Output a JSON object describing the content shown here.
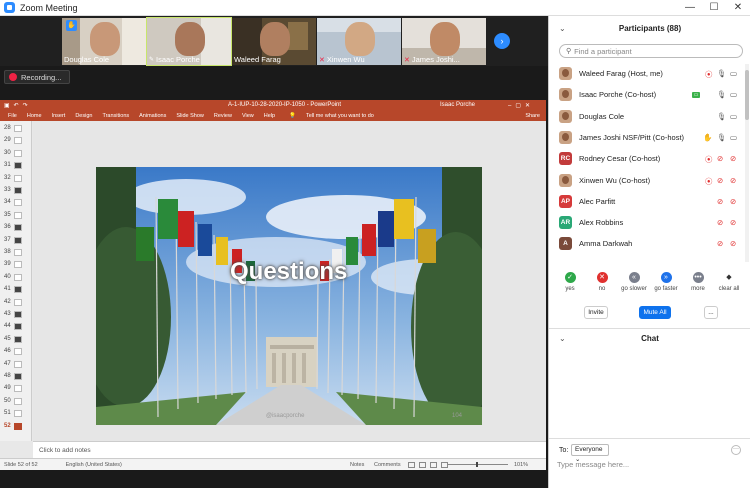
{
  "window": {
    "title": "Zoom Meeting",
    "controls": [
      "—",
      "☐",
      "✕"
    ]
  },
  "video_strip": {
    "tiles": [
      {
        "name": "Douglas Cole",
        "muted": false,
        "active": false
      },
      {
        "name": "Isaac Porche",
        "muted": false,
        "active": true
      },
      {
        "name": "Waleed Farag",
        "muted": false,
        "active": false
      },
      {
        "name": "Xinwen Wu",
        "muted": true,
        "active": false
      },
      {
        "name": "James Joshi...",
        "muted": true,
        "active": false
      }
    ],
    "next_icon": "chevron-right-icon"
  },
  "recording": {
    "label": "Recording..."
  },
  "ppt": {
    "doc_title": "A-1-IUP-10-28-2020-IP-1050  -  PowerPoint",
    "user": "Isaac Porche",
    "ribbon": [
      "File",
      "Home",
      "Insert",
      "Design",
      "Transitions",
      "Animations",
      "Slide Show",
      "Review",
      "View",
      "Help"
    ],
    "tell_me": "Tell me what you want to do",
    "share": "Share",
    "thumbs": [
      "28",
      "29",
      "30",
      "31",
      "32",
      "33",
      "34",
      "35",
      "36",
      "37",
      "38",
      "39",
      "40",
      "41",
      "42",
      "43",
      "44",
      "45",
      "46",
      "47",
      "48",
      "49",
      "50",
      "51",
      "52"
    ],
    "current_slide": "52",
    "slide_title": "Questions",
    "watermark": "@isaacporche",
    "page_number": "104",
    "notes_placeholder": "Click to add notes",
    "status": {
      "slide": "Slide 52 of 52",
      "language": "English (United States)",
      "notes": "Notes",
      "comments": "Comments",
      "zoom": "101%"
    }
  },
  "participants": {
    "header": "Participants (88)",
    "search_placeholder": "Find a participant",
    "list": [
      {
        "name": "Waleed Farag (Host, me)",
        "avatar": "photo",
        "initials": "",
        "color": "#c9a284"
      },
      {
        "name": "Isaac Porche (Co-host)",
        "avatar": "photo",
        "initials": "",
        "color": "#c9a284"
      },
      {
        "name": "Douglas Cole",
        "avatar": "photo",
        "initials": "",
        "color": "#c9a284"
      },
      {
        "name": "James Joshi NSF/Pitt (Co-host)",
        "avatar": "photo",
        "initials": "",
        "color": "#c9a284"
      },
      {
        "name": "Rodney Cesar (Co-host)",
        "avatar": "initials",
        "initials": "RC",
        "color": "#c23b3b"
      },
      {
        "name": "Xinwen Wu (Co-host)",
        "avatar": "photo",
        "initials": "",
        "color": "#c9a284"
      },
      {
        "name": "Alec Parfitt",
        "avatar": "initials",
        "initials": "AP",
        "color": "#d63a3a"
      },
      {
        "name": "Alex Robbins",
        "avatar": "initials",
        "initials": "AR",
        "color": "#2aa876"
      },
      {
        "name": "Amma Darkwah",
        "avatar": "initials",
        "initials": "A",
        "color": "#7a4a3a"
      }
    ],
    "reactions": [
      {
        "label": "yes",
        "symbol": "✓",
        "color": "#2ea84a",
        "icon": "check-icon"
      },
      {
        "label": "no",
        "symbol": "✕",
        "color": "#e0312f",
        "icon": "x-icon"
      },
      {
        "label": "go slower",
        "symbol": "«",
        "color": "#7a7f8c",
        "icon": "slower-icon"
      },
      {
        "label": "go faster",
        "symbol": "»",
        "color": "#1f72ea",
        "icon": "faster-icon"
      },
      {
        "label": "more",
        "symbol": "•••",
        "color": "#7a7f8c",
        "icon": "more-icon"
      },
      {
        "label": "clear all",
        "symbol": "◆",
        "color": "#ffffff",
        "icon": "eraser-icon"
      }
    ],
    "actions": {
      "invite": "Invite",
      "mute_all": "Mute All",
      "more": "..."
    }
  },
  "chat": {
    "header": "Chat",
    "to_label": "To:",
    "recipient": "Everyone",
    "more": "···",
    "message_placeholder": "Type message here..."
  }
}
